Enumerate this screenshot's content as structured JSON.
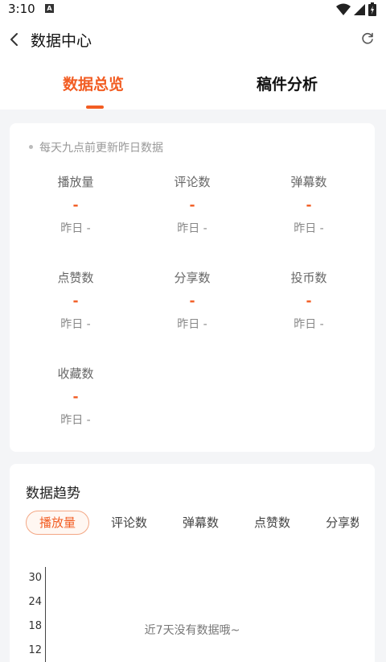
{
  "status": {
    "time": "3:10",
    "notif": "A"
  },
  "header": {
    "title": "数据中心"
  },
  "tabs": [
    {
      "label": "数据总览",
      "active": true
    },
    {
      "label": "稿件分析",
      "active": false
    }
  ],
  "overview": {
    "note": "每天九点前更新昨日数据",
    "metrics": [
      {
        "label": "播放量",
        "value": "-",
        "yesterday": "昨日 -"
      },
      {
        "label": "评论数",
        "value": "-",
        "yesterday": "昨日 -"
      },
      {
        "label": "弹幕数",
        "value": "-",
        "yesterday": "昨日 -"
      },
      {
        "label": "点赞数",
        "value": "-",
        "yesterday": "昨日 -"
      },
      {
        "label": "分享数",
        "value": "-",
        "yesterday": "昨日 -"
      },
      {
        "label": "投币数",
        "value": "-",
        "yesterday": "昨日 -"
      },
      {
        "label": "收藏数",
        "value": "-",
        "yesterday": "昨日 -"
      }
    ]
  },
  "trend": {
    "title": "数据趋势",
    "chips": [
      "播放量",
      "评论数",
      "弹幕数",
      "点赞数",
      "分享数"
    ],
    "y_ticks": [
      "30",
      "24",
      "18",
      "12"
    ],
    "empty_text": "近7天没有数据哦~"
  },
  "colors": {
    "accent": "#f25d23"
  }
}
